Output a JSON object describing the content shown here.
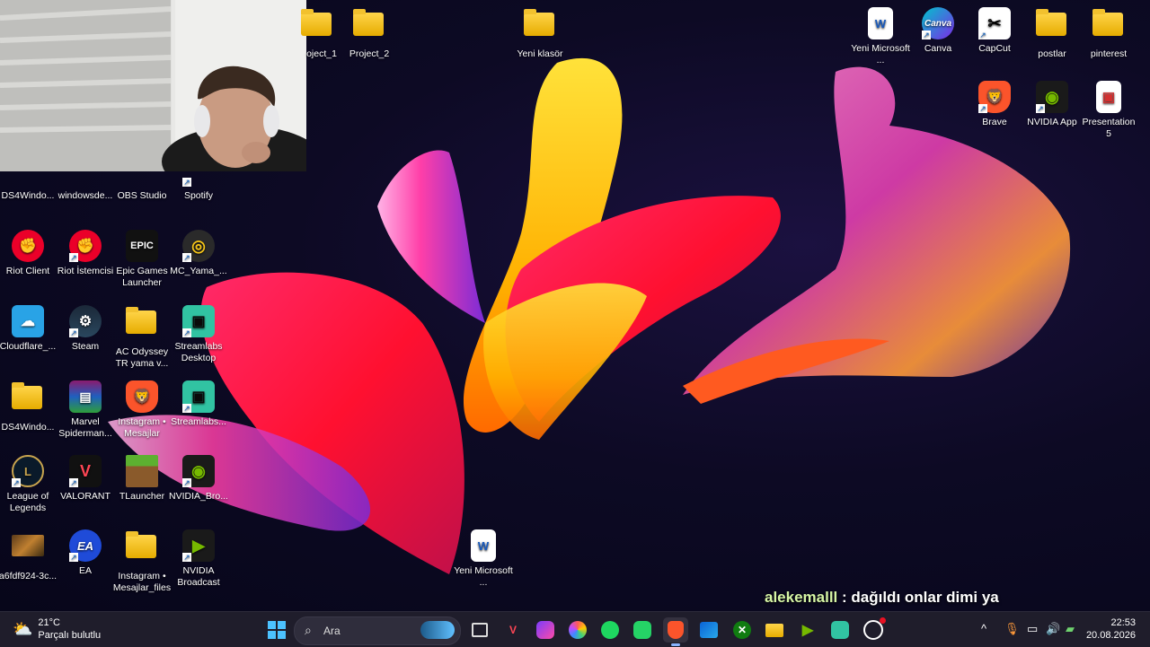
{
  "desktop_icons": {
    "project_1": "oject_1",
    "project_2": "Project_2",
    "yeni_klasor": "Yeni klasör",
    "word_doc_top": "Yeni Microsoft ...",
    "canva": "Canva",
    "capcut": "CapCut",
    "postlar": "postlar",
    "pinterest": "pinterest",
    "brave": "Brave",
    "nvidia_app": "NVIDIA App",
    "presentation5": "Presentation 5",
    "ds4windows_1": "DS4Windo...",
    "windowsdefender": "windowsde...",
    "obs": "OBS Studio",
    "spotify": "Spotify",
    "riot_client": "Riot Client",
    "riot_istemcisi": "Riot İstemcisi",
    "epic": "Epic Games Launcher",
    "mc_yama": "MC_Yama_...",
    "cloudflare": "Cloudflare_...",
    "steam": "Steam",
    "ac_odyssey": "AC Odyssey TR yama v...",
    "streamlabs_desktop": "Streamlabs Desktop",
    "ds4windows_2": "DS4Windo...",
    "marvel": "Marvel Spiderman...",
    "instagram_mesajlar": "Instagram • Mesajlar",
    "streamlabs": "Streamlabs...",
    "lol": "League of Legends",
    "valorant": "VALORANT",
    "tlauncher": "TLauncher",
    "nvidia_bro": "NVIDIA_Bro...",
    "a6fdf924": "a6fdf924-3c...",
    "ea": "EA",
    "instagram_files": "Instagram • Mesajlar_files",
    "nvidia_broadcast": "NVIDIA Broadcast",
    "word_doc_bottom": "Yeni Microsoft ..."
  },
  "icon_glyphs": {
    "epic": "EPIC",
    "ea": "EA",
    "word": "W",
    "canva": "Canva"
  },
  "chat": {
    "username": "alekemalll",
    "message": " : dağıldı onlar dimi ya"
  },
  "taskbar": {
    "weather_temp": "21°C",
    "weather_desc": "Parçalı bulutlu",
    "search_placeholder": "Ara",
    "time": "22:53",
    "date": "20.08.2026"
  },
  "colors": {
    "taskbar_bg": "#1f1d2b",
    "chat_user": "#d6f5a5",
    "folder": "#ffd54a"
  }
}
